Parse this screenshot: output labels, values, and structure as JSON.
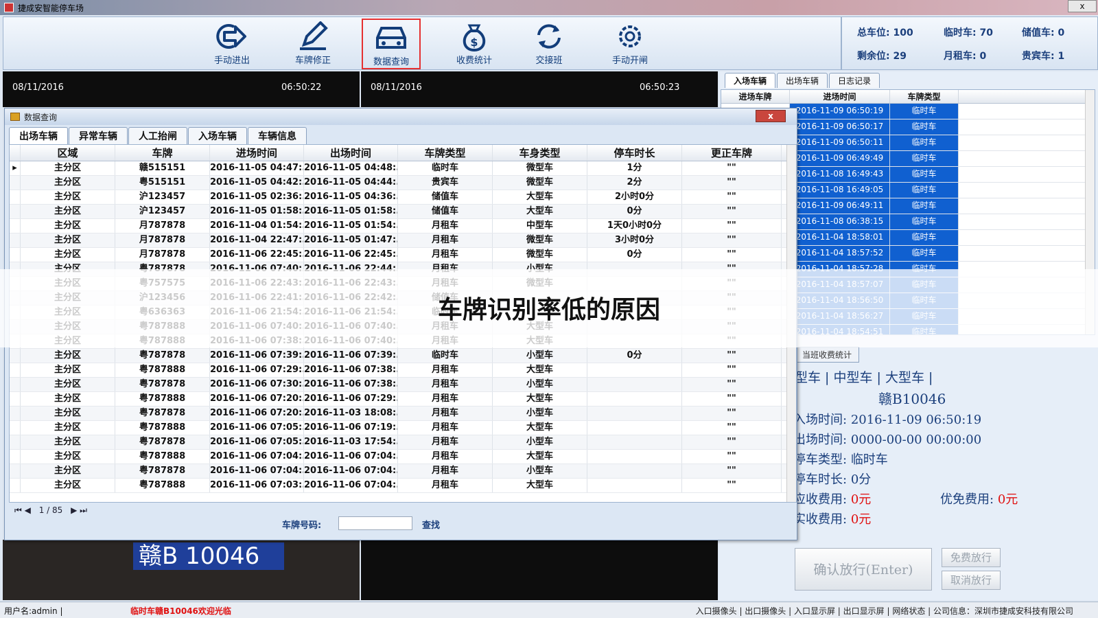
{
  "window": {
    "title": "捷成安智能停车场",
    "close": "x"
  },
  "toolbar": {
    "buttons": [
      {
        "label": "手动进出",
        "icon": "exit-arrow-icon"
      },
      {
        "label": "车牌修正",
        "icon": "pencil-icon"
      },
      {
        "label": "数据查询",
        "icon": "car-icon"
      },
      {
        "label": "收费统计",
        "icon": "money-bag-icon"
      },
      {
        "label": "交接班",
        "icon": "refresh-icon"
      },
      {
        "label": "手动开闸",
        "icon": "gear-icon"
      }
    ]
  },
  "stats": {
    "total": "总车位: 100",
    "temp": "临时车: 70",
    "stored": "储值车: 0",
    "remain": "剩余位: 29",
    "monthly": "月租车: 0",
    "vip": "贵宾车: 1"
  },
  "video": {
    "left_date": "08/11/2016",
    "left_time": "06:50:22",
    "right_date": "08/11/2016",
    "right_time": "06:50:23",
    "plate_overlay": "赣B 10046"
  },
  "right": {
    "tabs": [
      "入场车辆",
      "出场车辆",
      "日志记录"
    ],
    "headers": [
      "进场车牌",
      "进场时间",
      "车牌类型"
    ],
    "rows": [
      [
        "",
        "2016-11-09 06:50:19",
        "临时车"
      ],
      [
        "",
        "2016-11-09 06:50:17",
        "临时车"
      ],
      [
        "",
        "2016-11-09 06:50:11",
        "临时车"
      ],
      [
        "",
        "2016-11-09 06:49:49",
        "临时车"
      ],
      [
        "",
        "2016-11-08 16:49:43",
        "临时车"
      ],
      [
        "",
        "2016-11-08 16:49:05",
        "临时车"
      ],
      [
        "",
        "2016-11-09 06:49:11",
        "临时车"
      ],
      [
        "",
        "2016-11-08 06:38:15",
        "临时车"
      ],
      [
        "",
        "2016-11-04 18:58:01",
        "临时车"
      ],
      [
        "",
        "2016-11-04 18:57:52",
        "临时车"
      ],
      [
        "",
        "2016-11-04 18:57:28",
        "临时车"
      ],
      [
        "",
        "2016-11-04 18:57:07",
        "临时车"
      ],
      [
        "",
        "2016-11-04 18:56:50",
        "临时车"
      ],
      [
        "",
        "2016-11-04 18:56:27",
        "临时车"
      ],
      [
        "",
        "2016-11-04 18:54:51",
        "临时车"
      ]
    ]
  },
  "fee": {
    "tab": "当班收费统计",
    "types": "型车 | 中型车 | 大型车 |",
    "plate": "赣B10046",
    "in_label": "入场时间:",
    "in_value": "2016-11-09 06:50:19",
    "out_label": "出场时间:",
    "out_value": "0000-00-00 00:00:00",
    "ptype_label": "停车类型:",
    "ptype_value": "临时车",
    "dur_label": "停车时长:",
    "dur_value": "0分",
    "due_label": "应收费用:",
    "due_value": "0元",
    "disc_label": "优免费用:",
    "disc_value": "0元",
    "paid_label": "实收费用:",
    "paid_value": "0元",
    "confirm": "确认放行(Enter)",
    "free": "免费放行",
    "cancel": "取消放行"
  },
  "dialog": {
    "title": "数据查询",
    "close": "x",
    "tabs": [
      "出场车辆",
      "异常车辆",
      "人工抬闸",
      "入场车辆",
      "车辆信息"
    ],
    "headers": [
      "区域",
      "车牌",
      "进场时间",
      "出场时间",
      "车牌类型",
      "车身类型",
      "停车时长",
      "更正车牌"
    ],
    "rows": [
      [
        "主分区",
        "赣515151",
        "2016-11-05 04:47:...",
        "2016-11-05 04:48:...",
        "临时车",
        "微型车",
        "1分",
        "\"\""
      ],
      [
        "主分区",
        "粤515151",
        "2016-11-05 04:42:...",
        "2016-11-05 04:44:...",
        "贵宾车",
        "微型车",
        "2分",
        "\"\""
      ],
      [
        "主分区",
        "沪123457",
        "2016-11-05 02:36:...",
        "2016-11-05 04:36:...",
        "储值车",
        "大型车",
        "2小时0分",
        "\"\""
      ],
      [
        "主分区",
        "沪123457",
        "2016-11-05 01:58:...",
        "2016-11-05 01:58:...",
        "储值车",
        "大型车",
        "0分",
        "\"\""
      ],
      [
        "主分区",
        "月787878",
        "2016-11-04 01:54:...",
        "2016-11-05 01:54:...",
        "月租车",
        "中型车",
        "1天0小时0分",
        "\"\""
      ],
      [
        "主分区",
        "月787878",
        "2016-11-04 22:47:...",
        "2016-11-05 01:47:...",
        "月租车",
        "微型车",
        "3小时0分",
        "\"\""
      ],
      [
        "主分区",
        "月787878",
        "2016-11-06 22:45:...",
        "2016-11-06 22:45:...",
        "月租车",
        "微型车",
        "0分",
        "\"\""
      ],
      [
        "主分区",
        "粤787878",
        "2016-11-06 07:40:...",
        "2016-11-06 22:44:...",
        "月租车",
        "小型车",
        "",
        "\"\""
      ],
      [
        "主分区",
        "粤757575",
        "2016-11-06 22:43:...",
        "2016-11-06 22:43:...",
        "月租车",
        "微型车",
        "",
        "\"\""
      ],
      [
        "主分区",
        "沪123456",
        "2016-11-06 22:41:...",
        "2016-11-06 22:42:...",
        "储值车",
        "",
        "",
        "\"\""
      ],
      [
        "主分区",
        "粤636363",
        "2016-11-06 21:54:...",
        "2016-11-06 21:54:...",
        "临时车",
        "",
        "",
        "\"\""
      ],
      [
        "主分区",
        "粤787888",
        "2016-11-06 07:40:...",
        "2016-11-06 07:40:...",
        "月租车",
        "大型车",
        "",
        "\"\""
      ],
      [
        "主分区",
        "粤787888",
        "2016-11-06 07:38:...",
        "2016-11-06 07:40:...",
        "月租车",
        "大型车",
        "",
        "\"\""
      ],
      [
        "主分区",
        "粤787878",
        "2016-11-06 07:39:...",
        "2016-11-06 07:39:...",
        "临时车",
        "小型车",
        "0分",
        "\"\""
      ],
      [
        "主分区",
        "粤787888",
        "2016-11-06 07:29:...",
        "2016-11-06 07:38:...",
        "月租车",
        "大型车",
        "",
        "\"\""
      ],
      [
        "主分区",
        "粤787878",
        "2016-11-06 07:30:...",
        "2016-11-06 07:38:...",
        "月租车",
        "小型车",
        "",
        "\"\""
      ],
      [
        "主分区",
        "粤787888",
        "2016-11-06 07:20:...",
        "2016-11-06 07:29:...",
        "月租车",
        "大型车",
        "",
        "\"\""
      ],
      [
        "主分区",
        "粤787878",
        "2016-11-06 07:20:...",
        "2016-11-03 18:08:...",
        "月租车",
        "小型车",
        "",
        "\"\""
      ],
      [
        "主分区",
        "粤787888",
        "2016-11-06 07:05:...",
        "2016-11-06 07:19:...",
        "月租车",
        "大型车",
        "",
        "\"\""
      ],
      [
        "主分区",
        "粤787878",
        "2016-11-06 07:05:...",
        "2016-11-03 17:54:...",
        "月租车",
        "小型车",
        "",
        "\"\""
      ],
      [
        "主分区",
        "粤787888",
        "2016-11-06 07:04:...",
        "2016-11-06 07:04:...",
        "月租车",
        "大型车",
        "",
        "\"\""
      ],
      [
        "主分区",
        "粤787878",
        "2016-11-06 07:04:...",
        "2016-11-06 07:04:...",
        "月租车",
        "小型车",
        "",
        "\"\""
      ],
      [
        "主分区",
        "粤787888",
        "2016-11-06 07:03:...",
        "2016-11-06 07:04:...",
        "月租车",
        "大型车",
        "",
        "\"\""
      ]
    ],
    "pager": "1 / 85",
    "search_label": "车牌号码:",
    "search_value": "",
    "find": "查找"
  },
  "banner": "车牌识别率低的原因",
  "statusbar": {
    "user": "用户名:admin |",
    "welcome": "临时车赣B10046欢迎光临",
    "links": "入口摄像头 | 出口摄像头 | 入口显示屏 | 出口显示屏 | 网络状态 | 公司信息：深圳市捷成安科技有限公司"
  }
}
